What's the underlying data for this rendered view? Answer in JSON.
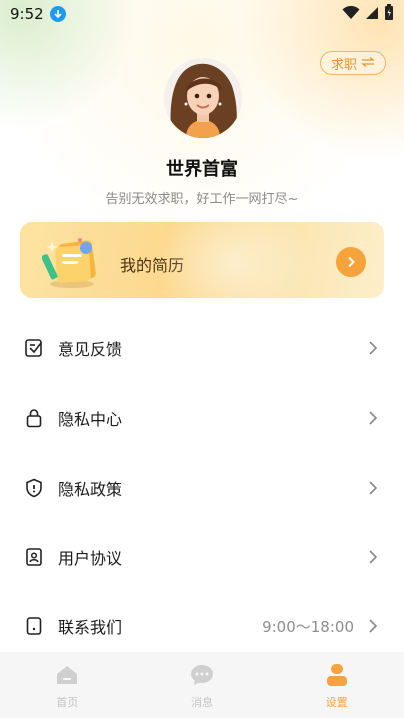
{
  "status_bar": {
    "time": "9:52"
  },
  "header": {
    "switch_label": "求职",
    "user_name": "世界首富",
    "slogan": "告别无效求职，好工作一网打尽~"
  },
  "resume_card": {
    "label": "我的简历"
  },
  "menu": [
    {
      "label": "意见反馈",
      "icon": "feedback-icon"
    },
    {
      "label": "隐私中心",
      "icon": "lock-icon"
    },
    {
      "label": "隐私政策",
      "icon": "shield-icon"
    },
    {
      "label": "用户协议",
      "icon": "agreement-icon"
    },
    {
      "label": "联系我们",
      "icon": "phone-icon",
      "extra": "9:00～18:00"
    }
  ],
  "tabs": [
    {
      "label": "首页",
      "icon": "home-icon",
      "active": false
    },
    {
      "label": "消息",
      "icon": "message-icon",
      "active": false
    },
    {
      "label": "设置",
      "icon": "profile-icon",
      "active": true
    }
  ],
  "colors": {
    "accent": "#f6a33c",
    "card_bg": "#fcd98f",
    "tab_inactive": "#c4c4c4"
  }
}
